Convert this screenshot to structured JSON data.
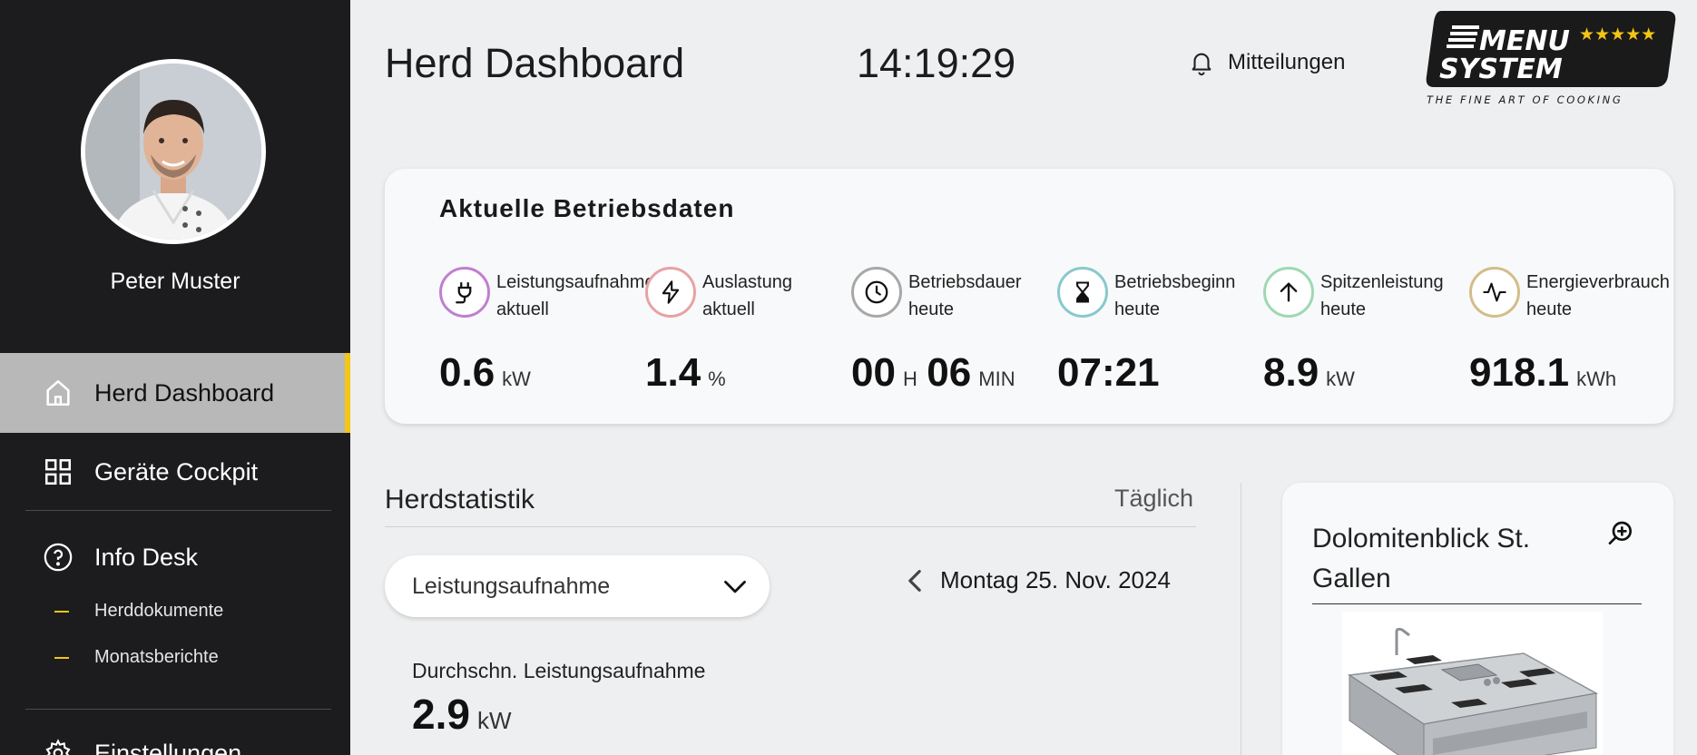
{
  "sidebar": {
    "user_name": "Peter Muster",
    "nav": [
      {
        "label": "Herd Dashboard",
        "icon": "home-icon",
        "active": true
      },
      {
        "label": "Geräte Cockpit",
        "icon": "grid-icon"
      },
      {
        "label": "Info Desk",
        "icon": "help-circle-icon"
      }
    ],
    "sub_items": [
      "Herddokumente",
      "Monatsberichte"
    ],
    "settings_label": "Einstellungen",
    "accent_color": "#f3c515"
  },
  "header": {
    "title": "Herd Dashboard",
    "time": "14:19:29",
    "notifications_label": "Mitteilungen",
    "logo": {
      "line1": "MENU",
      "line2": "SYSTEM",
      "stars": "★★★★★",
      "tagline": "THE FINE ART OF COOKING"
    }
  },
  "ops": {
    "title": "Aktuelle Betriebsdaten",
    "metrics": [
      {
        "label1": "Leistungsaufnahme",
        "label2": "aktuell",
        "value": "0.6",
        "unit": "kW",
        "icon": "plug-icon",
        "color": "#c07fd0"
      },
      {
        "label1": "Auslastung",
        "label2": "aktuell",
        "value": "1.4",
        "unit": "%",
        "icon": "lightning-icon",
        "color": "#e7a2a2"
      },
      {
        "label1": "Betriebsdauer",
        "label2": "heute",
        "value_h": "00",
        "unit_h": "H",
        "value_m": "06",
        "unit_m": "MIN",
        "icon": "clock-icon",
        "color": "#a8a8a8"
      },
      {
        "label1": "Betriebsbeginn",
        "label2": "heute",
        "value": "07:21",
        "unit": "",
        "icon": "hourglass-icon",
        "color": "#88c9cd"
      },
      {
        "label1": "Spitzenleistung",
        "label2": "heute",
        "value": "8.9",
        "unit": "kW",
        "icon": "arrow-up-icon",
        "color": "#9ed8b2"
      },
      {
        "label1": "Energieverbrauch",
        "label2": "heute",
        "value": "918.1",
        "unit": "kWh",
        "icon": "pulse-icon",
        "color": "#d3bd88"
      }
    ]
  },
  "stats": {
    "title": "Herdstatistik",
    "period": "Täglich",
    "dropdown_value": "Leistungsaufnahme",
    "date": "Montag 25. Nov. 2024",
    "avg_label": "Durchschn. Leistungsaufnahme",
    "avg_value": "2.9",
    "avg_unit": "kW"
  },
  "location": {
    "title": "Dolomitenblick St. Gallen"
  }
}
